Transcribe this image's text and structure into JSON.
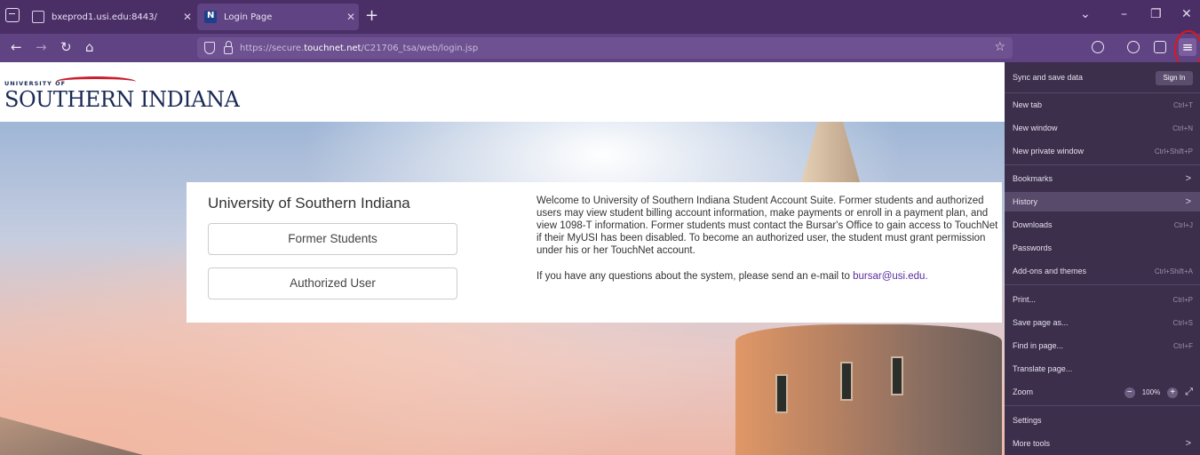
{
  "browser": {
    "tabs": [
      {
        "label": "bxeprod1.usi.edu:8443/"
      },
      {
        "label": "Login Page"
      }
    ],
    "new_tab": "+",
    "url_prefix": "https://secure.",
    "url_domain": "touchnet.net",
    "url_path": "/C21706_tsa/web/login.jsp"
  },
  "logo": {
    "top": "UNIVERSITY OF",
    "name": "SOUTHERN INDIANA"
  },
  "card": {
    "title": "University of Southern Indiana",
    "buttons": [
      "Former Students",
      "Authorized User"
    ],
    "description": "Welcome to University of Southern Indiana Student Account Suite. Former students and authorized users may view student billing account information, make payments or enroll in a payment plan, and view 1098-T information. Former students must contact the Bursar's Office to gain access to TouchNet if their MyUSI has been disabled. To become an authorized user, the student must grant permission under his or her TouchNet account.",
    "contact_text": "If you have any questions about the system, please send an e-mail to",
    "contact_email": "bursar@usi.edu."
  },
  "menu": {
    "sync": "Sync and save data",
    "sign_in": "Sign In",
    "items": [
      {
        "label": "New tab",
        "shortcut": "Ctrl+T"
      },
      {
        "label": "New window",
        "shortcut": "Ctrl+N"
      },
      {
        "label": "New private window",
        "shortcut": "Ctrl+Shift+P"
      },
      {
        "label": "Bookmarks",
        "shortcut": ">"
      },
      {
        "label": "History",
        "shortcut": ">"
      },
      {
        "label": "Downloads",
        "shortcut": "Ctrl+J"
      },
      {
        "label": "Passwords",
        "shortcut": ""
      },
      {
        "label": "Add-ons and themes",
        "shortcut": "Ctrl+Shift+A"
      },
      {
        "label": "Print...",
        "shortcut": "Ctrl+P"
      },
      {
        "label": "Save page as...",
        "shortcut": "Ctrl+S"
      },
      {
        "label": "Find in page...",
        "shortcut": "Ctrl+F"
      },
      {
        "label": "Translate page...",
        "shortcut": ""
      },
      {
        "label": "Zoom",
        "shortcut": ""
      },
      {
        "label": "Settings",
        "shortcut": ""
      },
      {
        "label": "More tools",
        "shortcut": ">"
      }
    ],
    "zoom_value": "100%",
    "highlighted": "History"
  },
  "colors": {
    "tabbar": "#4a2f67",
    "navbar": "#5f4382",
    "menu_bg": "#3b2f4c",
    "highlight_ring": "#e0161b",
    "link": "#5a2ea0"
  }
}
